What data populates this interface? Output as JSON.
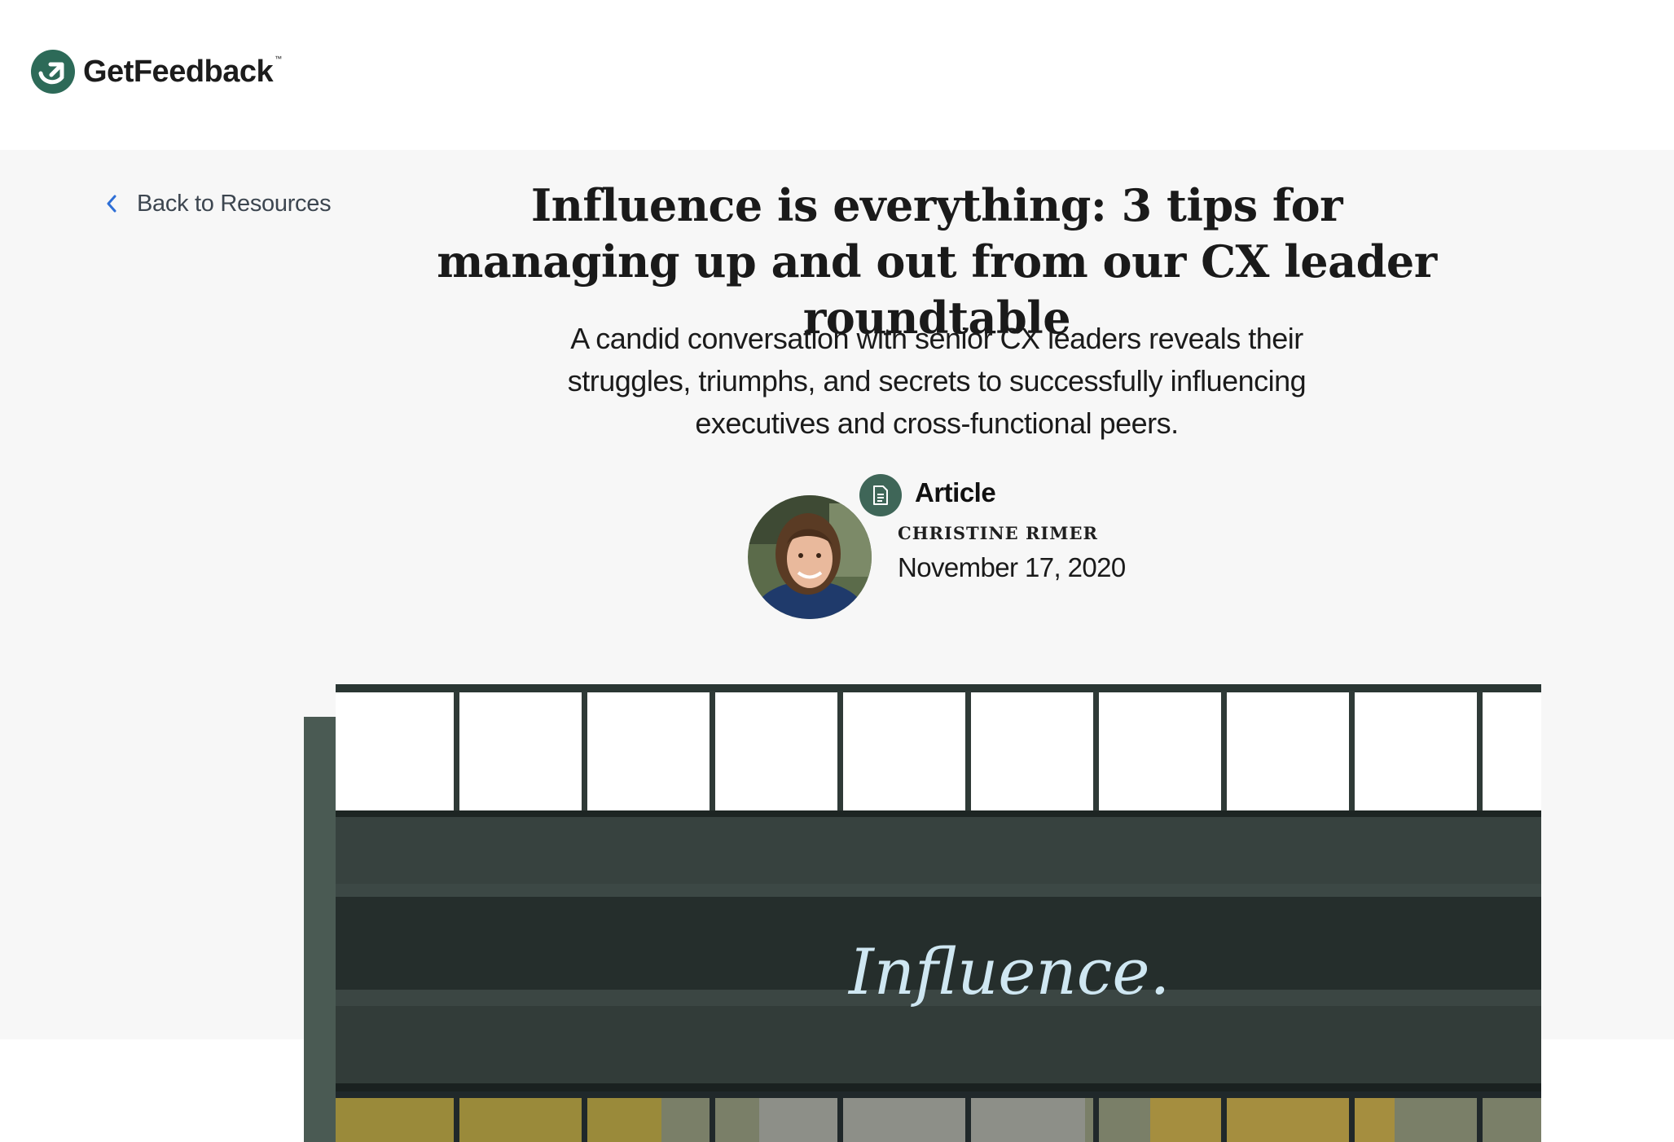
{
  "header": {
    "logo_text": "GetFeedback",
    "logo_tm": "™"
  },
  "nav": {
    "back_label": "Back to Resources"
  },
  "article": {
    "title": "Influence is everything: 3 tips for managing up and out from our CX leader roundtable",
    "subtitle": "A candid conversation with senior CX leaders reveals their struggles, triumphs, and secrets to successfully influencing executives and cross-functional peers.",
    "type": "Article",
    "author": "CHRISTINE RIMER",
    "date": "November 17, 2020",
    "hero_image_text": "Influence."
  },
  "colors": {
    "brand_green": "#3f6658",
    "back_link": "#2e6fd6",
    "hero_bg": "#f7f7f7"
  },
  "icons": {
    "logo": "getfeedback-logo-icon",
    "back": "chevron-left-icon",
    "type": "document-icon"
  }
}
